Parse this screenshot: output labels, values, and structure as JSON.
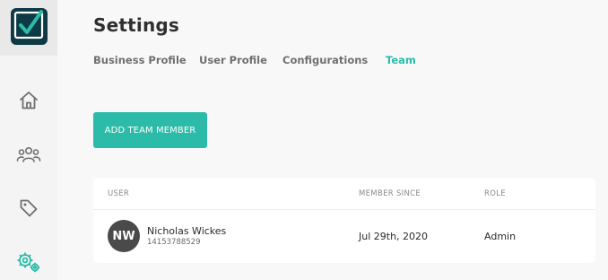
{
  "sidebar": {
    "items": [
      {
        "name": "home",
        "icon": "home-icon"
      },
      {
        "name": "team",
        "icon": "users-icon"
      },
      {
        "name": "tags",
        "icon": "tag-icon"
      },
      {
        "name": "settings",
        "icon": "gear-icon",
        "active": true
      }
    ],
    "accent_color": "#2bbba8",
    "icon_color": "#6f6f6f"
  },
  "page": {
    "title": "Settings"
  },
  "tabs": [
    {
      "label": "Business Profile",
      "active": false
    },
    {
      "label": "User Profile",
      "active": false
    },
    {
      "label": "Configurations",
      "active": false
    },
    {
      "label": "Team",
      "active": true
    }
  ],
  "actions": {
    "add_team_member": "ADD TEAM MEMBER"
  },
  "team_table": {
    "columns": [
      "USER",
      "MEMBER SINCE",
      "ROLE"
    ],
    "rows": [
      {
        "initials": "NW",
        "name": "Nicholas Wickes",
        "phone": "14153788529",
        "member_since": "Jul 29th, 2020",
        "role": "Admin"
      }
    ]
  },
  "colors": {
    "accent": "#2bbba8",
    "logo_background": "#0e3a45",
    "avatar_background": "#4a4a4a"
  }
}
